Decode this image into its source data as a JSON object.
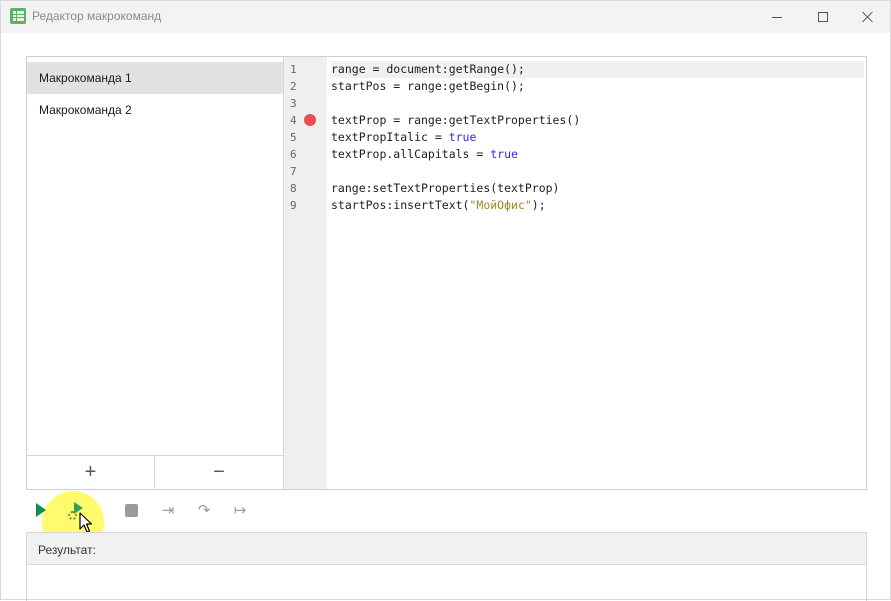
{
  "window": {
    "title": "Редактор макрокоманд",
    "minimize_icon": "minimize-icon",
    "maximize_icon": "maximize-icon",
    "close_icon": "close-icon"
  },
  "macros": {
    "items": [
      {
        "label": "Макрокоманда 1",
        "selected": true
      },
      {
        "label": "Макрокоманда 2",
        "selected": false
      }
    ],
    "add_label": "+",
    "remove_label": "−"
  },
  "editor": {
    "line_numbers": [
      "1",
      "2",
      "3",
      "4",
      "5",
      "6",
      "7",
      "8",
      "9"
    ],
    "breakpoint_line": 4,
    "current_line": 1,
    "lines": [
      "range = document:getRange();",
      "startPos = range:getBegin();",
      "",
      "textProp = range:getTextProperties()",
      "textPropItalic = true",
      "textProp.allCapitals = true",
      "",
      "range:setTextProperties(textProp)",
      "startPos:insertText(\"МойОфис\");"
    ]
  },
  "toolbar": {
    "run_icon": "play-icon",
    "debug_icon": "debug-run-icon",
    "stop_icon": "stop-icon",
    "step_into_icon": "step-into-icon",
    "step_over_icon": "step-over-icon",
    "step_out_icon": "step-out-icon"
  },
  "result": {
    "label": "Результат:"
  },
  "colors": {
    "accent_green": "#0f8f4a",
    "keyword": "#2d2ddb",
    "string": "#9a8a1c",
    "breakpoint": "#e94e4e"
  }
}
